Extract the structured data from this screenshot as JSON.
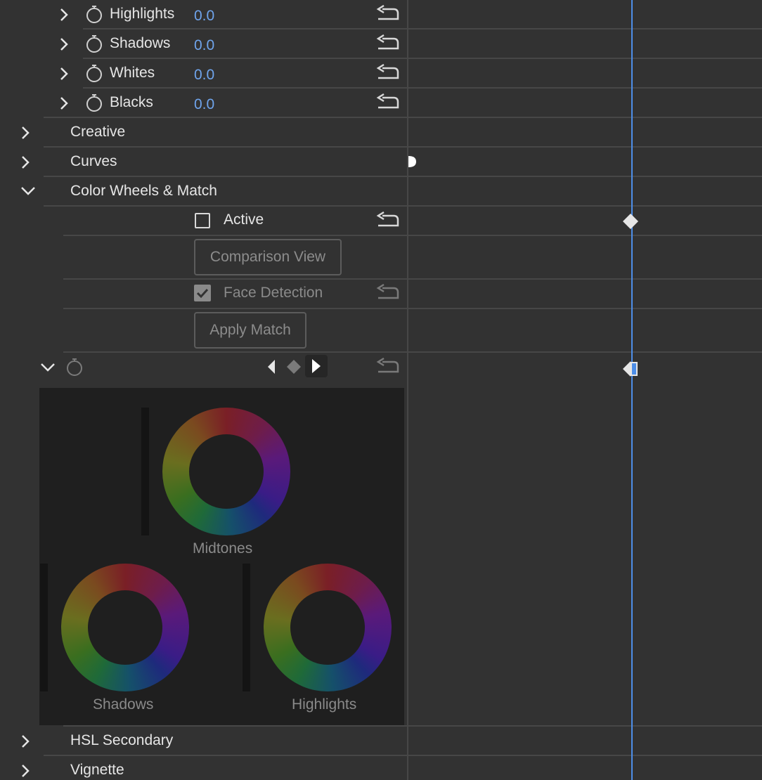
{
  "basic_rows": [
    {
      "label": "Highlights",
      "value": "0.0"
    },
    {
      "label": "Shadows",
      "value": "0.0"
    },
    {
      "label": "Whites",
      "value": "0.0"
    },
    {
      "label": "Blacks",
      "value": "0.0"
    }
  ],
  "sections": {
    "creative": "Creative",
    "curves": "Curves",
    "color_wheels": "Color Wheels & Match",
    "hsl_secondary": "HSL Secondary",
    "vignette": "Vignette"
  },
  "color_wheels": {
    "active_label": "Active",
    "active_checked": false,
    "comparison_view_label": "Comparison View",
    "face_detection_label": "Face Detection",
    "face_detection_checked": true,
    "apply_match_label": "Apply Match",
    "wheels": {
      "midtones": "Midtones",
      "shadows": "Shadows",
      "highlights": "Highlights"
    }
  },
  "colors": {
    "background": "#323232",
    "value_blue": "#6fa4ec",
    "playhead": "#4d8ee8",
    "wheel_panel": "#1f1f1f"
  },
  "icons": [
    "chevron-right-icon",
    "chevron-down-icon",
    "stopwatch-icon",
    "reset-icon",
    "keyframe-diamond-icon",
    "previous-keyframe-icon",
    "next-keyframe-icon",
    "checkbox-icon"
  ]
}
